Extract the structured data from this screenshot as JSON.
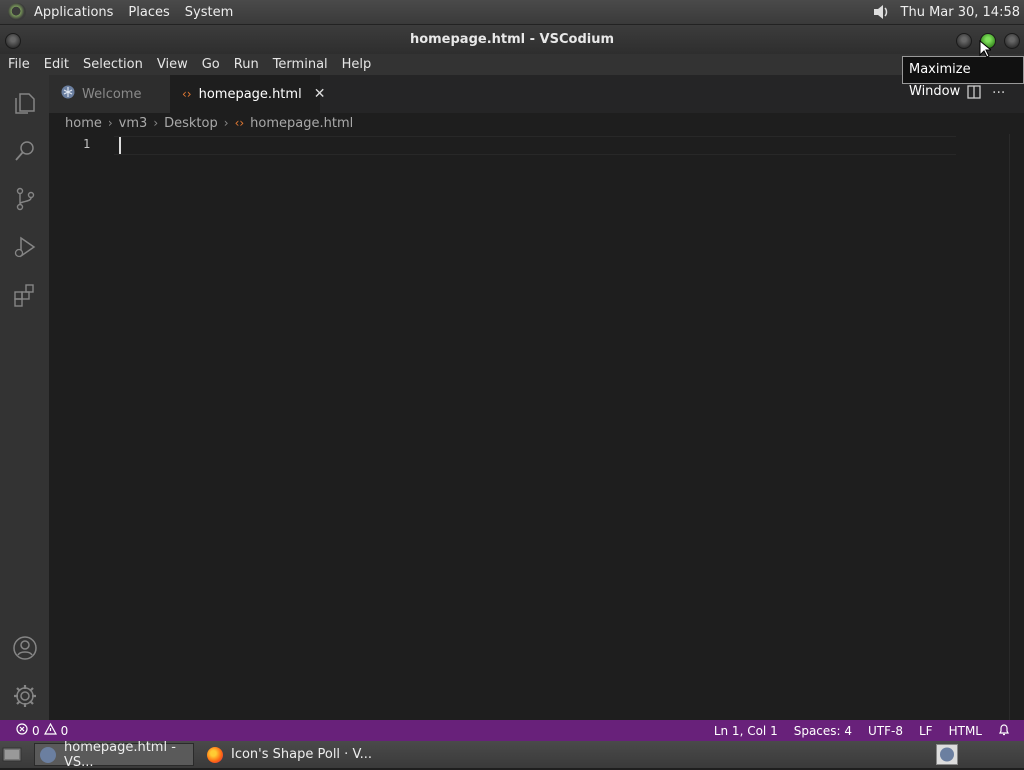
{
  "top_panel": {
    "menus": [
      "Applications",
      "Places",
      "System"
    ],
    "clock": "Thu Mar 30, 14:58"
  },
  "window": {
    "title": "homepage.html - VSCodium"
  },
  "menubar": {
    "items": [
      "File",
      "Edit",
      "Selection",
      "View",
      "Go",
      "Run",
      "Terminal",
      "Help"
    ]
  },
  "tooltip": "Maximize Window",
  "tabs": [
    {
      "label": "Welcome",
      "icon": "vscodium-icon",
      "active": false
    },
    {
      "label": "homepage.html",
      "icon": "html-file-icon",
      "active": true
    }
  ],
  "breadcrumb": [
    "home",
    "vm3",
    "Desktop",
    "homepage.html"
  ],
  "editor": {
    "line_numbers": [
      "1"
    ],
    "content": ""
  },
  "statusbar": {
    "errors": "0",
    "warnings": "0",
    "position": "Ln 1, Col 1",
    "spaces": "Spaces: 4",
    "encoding": "UTF-8",
    "eol": "LF",
    "language": "HTML",
    "color": "#68217a"
  },
  "taskbar": {
    "tasks": [
      {
        "label": "homepage.html - VS...",
        "icon": "vscodium-icon"
      },
      {
        "label": "Icon's Shape Poll · V...",
        "icon": "firefox-icon"
      }
    ]
  }
}
